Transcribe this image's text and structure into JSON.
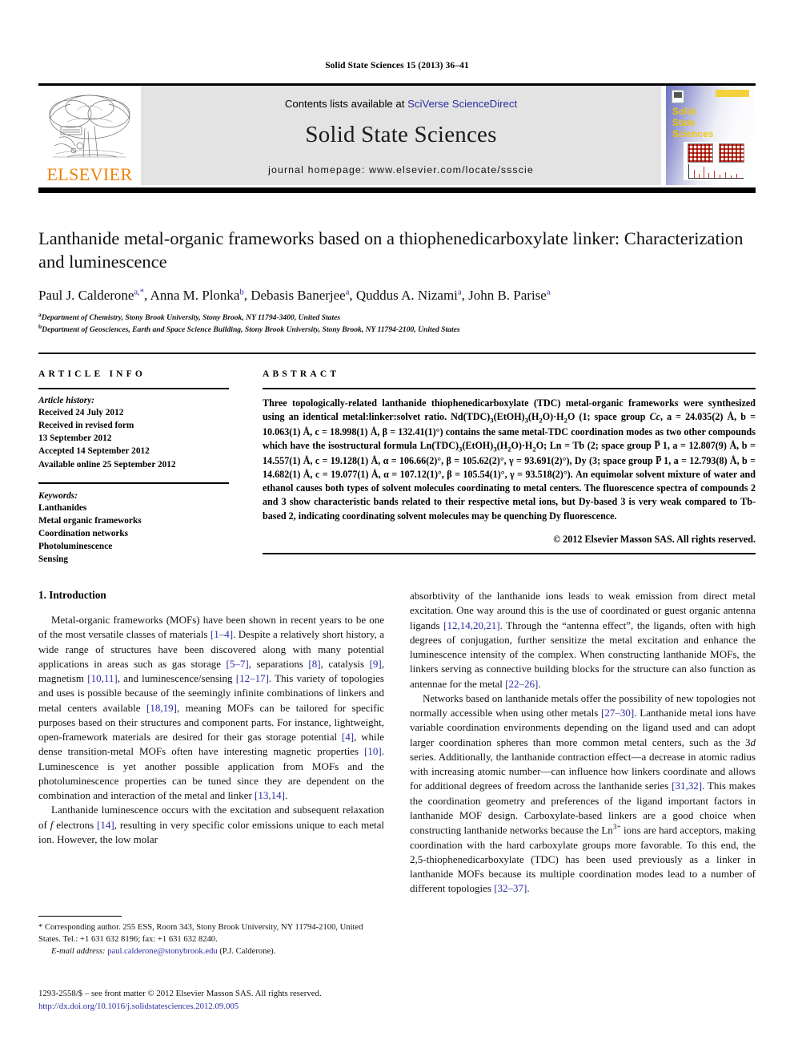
{
  "running_head": "Solid State Sciences 15 (2013) 36–41",
  "masthead": {
    "contents_prefix": "Contents lists available at ",
    "contents_link": "SciVerse ScienceDirect",
    "journal_title": "Solid State Sciences",
    "homepage": "journal homepage: www.elsevier.com/locate/ssscie",
    "publisher_logo_text": "ELSEVIER",
    "cover_title": "Solid\nState\nSciences"
  },
  "article": {
    "title": "Lanthanide metal-organic frameworks based on a thiophenedicarboxylate linker: Characterization and luminescence",
    "authors_html": "Paul J. Calderone<sup>a,*</sup>, Anna M. Plonka<sup>b</sup>, Debasis Banerjee<sup>a</sup>, Quddus A. Nizami<sup>a</sup>, John B. Parise<sup>a</sup>",
    "affiliations": [
      "Department of Chemistry, Stony Brook University, Stony Brook, NY 11794-3400, United States",
      "Department of Geosciences, Earth and Space Science Building, Stony Brook University, Stony Brook, NY 11794-2100, United States"
    ],
    "affiliation_marks": [
      "a",
      "b"
    ]
  },
  "article_info": {
    "heading": "ARTICLE INFO",
    "history_label": "Article history:",
    "history_lines": [
      "Received 24 July 2012",
      "Received in revised form",
      "13 September 2012",
      "Accepted 14 September 2012",
      "Available online 25 September 2012"
    ],
    "keywords_label": "Keywords:",
    "keywords": [
      "Lanthanides",
      "Metal organic frameworks",
      "Coordination networks",
      "Photoluminescence",
      "Sensing"
    ]
  },
  "abstract": {
    "heading": "ABSTRACT",
    "text_html": "Three topologically-related lanthanide thiophenedicarboxylate (TDC) metal-organic frameworks were synthesized using an identical metal:linker:solvet ratio. Nd(TDC)<sub>3</sub>(EtOH)<sub>3</sub>(H<sub>2</sub>O)·H<sub>2</sub>O (<b>1</b>; space group <i>Cc</i>, a = 24.035(2) Å, b = 10.063(1) Å, c = 18.998(1) Å, β = 132.41(1)°) contains the same metal-TDC coordination modes as two other compounds which have the isostructural formula Ln(TDC)<sub>3</sub>(EtOH)<sub>3</sub>(H<sub>2</sub>O)·H<sub>2</sub>O; Ln = Tb (<b>2</b>; space group P&#773; 1, a = 12.807(9) Å, b = 14.557(1) Å, c = 19.128(1) Å, α = 106.66(2)°, β = 105.62(2)°, γ = 93.691(2)°), Dy (<b>3</b>; space group P&#773; 1, a = 12.793(8) Å, b = 14.682(1) Å, c = 19.077(1) Å, α = 107.12(1)°, β = 105.54(1)°, γ = 93.518(2)°). An equimolar solvent mixture of water and ethanol causes both types of solvent molecules coordinating to metal centers. The fluorescence spectra of compounds <b>2</b> and <b>3</b> show characteristic bands related to their respective metal ions, but Dy-based <b>3</b> is very weak compared to Tb-based <b>2</b>, indicating coordinating solvent molecules may be quenching Dy fluorescence.",
    "copyright": "© 2012 Elsevier Masson SAS. All rights reserved."
  },
  "body": {
    "section_number_title": "1. Introduction",
    "left_paragraphs_html": [
      "Metal-organic frameworks (MOFs) have been shown in recent years to be one of the most versatile classes of materials <span class=\"ref\">[1–4]</span>. Despite a relatively short history, a wide range of structures have been discovered along with many potential applications in areas such as gas storage <span class=\"ref\">[5–7]</span>, separations <span class=\"ref\">[8]</span>, catalysis <span class=\"ref\">[9]</span>, magnetism <span class=\"ref\">[10,11]</span>, and luminescence/sensing <span class=\"ref\">[12–17]</span>. This variety of topologies and uses is possible because of the seemingly infinite combinations of linkers and metal centers available <span class=\"ref\">[18,19]</span>, meaning MOFs can be tailored for specific purposes based on their structures and component parts. For instance, lightweight, open-framework materials are desired for their gas storage potential <span class=\"ref\">[4]</span>, while dense transition-metal MOFs often have interesting magnetic properties <span class=\"ref\">[10]</span>. Luminescence is yet another possible application from MOFs and the photoluminescence properties can be tuned since they are dependent on the combination and interaction of the metal and linker <span class=\"ref\">[13,14]</span>.",
      "Lanthanide luminescence occurs with the excitation and subsequent relaxation of <i>f</i> electrons <span class=\"ref\">[14]</span>, resulting in very specific color emissions unique to each metal ion. However, the low molar"
    ],
    "right_paragraphs_html": [
      "absorbtivity of the lanthanide ions leads to weak emission from direct metal excitation. One way around this is the use of coordinated or guest organic antenna ligands <span class=\"ref\">[12,14,20,21]</span>. Through the “antenna effect”, the ligands, often with high degrees of conjugation, further sensitize the metal excitation and enhance the luminescence intensity of the complex. When constructing lanthanide MOFs, the linkers serving as connective building blocks for the structure can also function as antennae for the metal <span class=\"ref\">[22–26]</span>.",
      "Networks based on lanthanide metals offer the possibility of new topologies not normally accessible when using other metals <span class=\"ref\">[27–30]</span>. Lanthanide metal ions have variable coordination environments depending on the ligand used and can adopt larger coordination spheres than more common metal centers, such as the 3<i>d</i> series. Additionally, the lanthanide contraction effect—a decrease in atomic radius with increasing atomic number—can influence how linkers coordinate and allows for additional degrees of freedom across the lanthanide series <span class=\"ref\">[31,32]</span>. This makes the coordination geometry and preferences of the ligand important factors in lanthanide MOF design. Carboxylate-based linkers are a good choice when constructing lanthanide networks because the Ln<sup>3+</sup> ions are hard acceptors, making coordination with the hard carboxylate groups more favorable. To this end, the 2,5-thiophenedicarboxylate (TDC) has been used previously as a linker in lanthanide MOFs because its multiple coordination modes lead to a number of different topologies <span class=\"ref\">[32–37]</span>."
    ]
  },
  "footnotes": {
    "corresponding_html": "* Corresponding author. 255 ESS, Room 343, Stony Brook University, NY 11794-2100, United States. Tel.: +1 631 632 8196; fax: +1 631 632 8240.",
    "email_label": "E-mail address:",
    "email": "paul.calderone@stonybrook.edu",
    "email_suffix": "(P.J. Calderone)."
  },
  "footer": {
    "issn_line_html": "1293-2558/$ – see front matter © 2012 Elsevier Masson SAS. All rights reserved.",
    "doi": "http://dx.doi.org/10.1016/j.solidstatesciences.2012.09.005"
  },
  "colors": {
    "link": "#2c2ca0",
    "elsevier_orange": "#f08000",
    "masthead_grey": "#e3e3e3",
    "cover_yellow": "#f0c808"
  }
}
